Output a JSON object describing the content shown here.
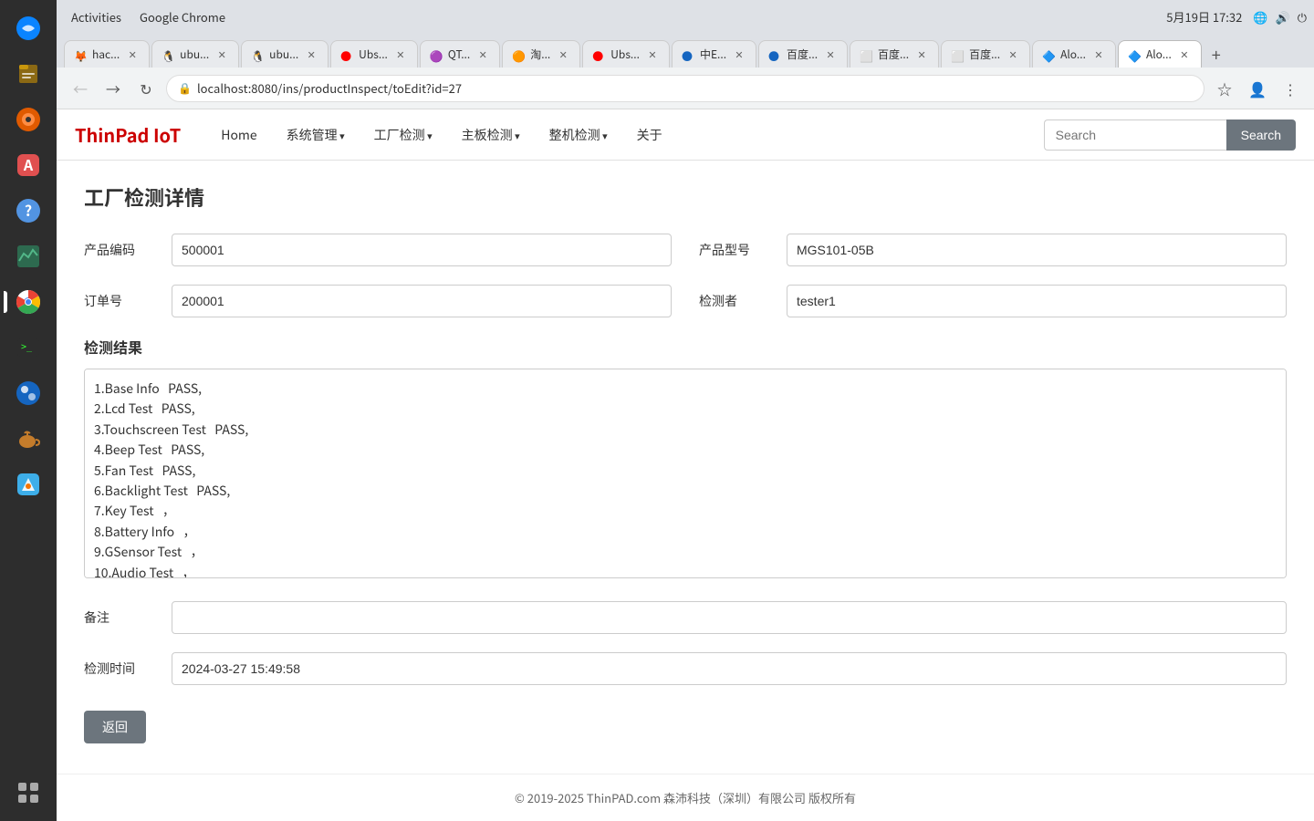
{
  "desktop": {
    "sidebar_icons": [
      {
        "name": "thunderbird-icon",
        "label": "Thunderbird"
      },
      {
        "name": "files-icon",
        "label": "Files"
      },
      {
        "name": "rhythmbox-icon",
        "label": "Rhythmbox"
      },
      {
        "name": "appstore-icon",
        "label": "App Store"
      },
      {
        "name": "help-icon",
        "label": "Help"
      },
      {
        "name": "monitor-icon",
        "label": "System Monitor"
      },
      {
        "name": "chrome-icon",
        "label": "Google Chrome",
        "active": true
      },
      {
        "name": "terminal-icon",
        "label": "Terminal"
      },
      {
        "name": "appimagekit-icon",
        "label": "AppImageKit"
      },
      {
        "name": "teapot-icon",
        "label": "Teapot"
      },
      {
        "name": "krita-icon",
        "label": "Krita"
      },
      {
        "name": "grid-icon",
        "label": "Show Applications"
      }
    ]
  },
  "browser": {
    "titlebar": {
      "activities": "Activities",
      "app_name": "Google Chrome",
      "datetime": "5月19日  17:32"
    },
    "tabs": [
      {
        "id": "tab1",
        "title": "hac...",
        "favicon": "🦊",
        "active": false
      },
      {
        "id": "tab2",
        "title": "ubu...",
        "favicon": "🐧",
        "active": false
      },
      {
        "id": "tab3",
        "title": "ubu...",
        "favicon": "🐧",
        "active": false
      },
      {
        "id": "tab4",
        "title": "Ubs...",
        "favicon": "🔴",
        "active": false
      },
      {
        "id": "tab5",
        "title": "QT...",
        "favicon": "🟣",
        "active": false
      },
      {
        "id": "tab6",
        "title": "淘...",
        "favicon": "🟠",
        "active": false
      },
      {
        "id": "tab7",
        "title": "Ubs...",
        "favicon": "🔴",
        "active": false
      },
      {
        "id": "tab8",
        "title": "中E...",
        "favicon": "🔵",
        "active": false
      },
      {
        "id": "tab9",
        "title": "百度...",
        "favicon": "🔵",
        "active": false
      },
      {
        "id": "tab10",
        "title": "百度...",
        "favicon": "⬜",
        "active": false
      },
      {
        "id": "tab11",
        "title": "百度...",
        "favicon": "⬜",
        "active": false
      },
      {
        "id": "tab12",
        "title": "Alo...",
        "favicon": "🔷",
        "active": false
      },
      {
        "id": "tab13",
        "title": "Alo...",
        "favicon": "🔷",
        "active": true
      }
    ],
    "address_bar": {
      "url": "localhost:8080/ins/productInspect/toEdit?id=27"
    }
  },
  "app": {
    "logo": "ThinPad IoT",
    "nav": {
      "home": "Home",
      "sys_manage": "系统管理",
      "factory_inspect": "工厂检测",
      "board_inspect": "主板检测",
      "full_inspect": "整机检测",
      "about": "关于"
    },
    "search": {
      "placeholder": "Search",
      "button_label": "Search"
    }
  },
  "page": {
    "title": "工厂检测详情",
    "fields": {
      "product_code_label": "产品编码",
      "product_code_value": "500001",
      "product_model_label": "产品型号",
      "product_model_value": "MGS101-05B",
      "order_number_label": "订单号",
      "order_number_value": "200001",
      "inspector_label": "检测者",
      "inspector_value": "tester1",
      "result_section_label": "检测结果",
      "result_text": "1.Base Info   PASS,\n2.Lcd Test   PASS,\n3.Touchscreen Test   PASS,\n4.Beep Test   PASS,\n5.Fan Test   PASS,\n6.Backlight Test   PASS,\n7.Key Test   ，\n8.Battery Info   ，\n9.GSensor Test   ，\n10.Audio Test   ，",
      "remark_label": "备注",
      "remark_value": "",
      "inspect_time_label": "检测时间",
      "inspect_time_value": "2024-03-27 15:49:58",
      "back_button": "返回"
    },
    "footer": {
      "text": "© 2019-2025 ThinPAD.com 森沛科技（深圳）有限公司 版权所有"
    }
  }
}
